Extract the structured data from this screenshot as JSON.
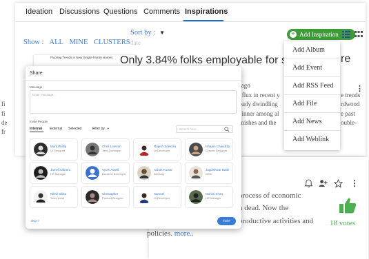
{
  "tabs": [
    "Ideation",
    "Discussions",
    "Questions",
    "Comments",
    "Inspirations"
  ],
  "active_tab": "Inspirations",
  "filters": {
    "show_label": "Show :",
    "options": [
      "ALL",
      "MINE",
      "CLUSTERS"
    ]
  },
  "sort": {
    "label": "Sort by :",
    "value": "date"
  },
  "add_button": {
    "label": "Add Inspiration",
    "color": "#3f9b3a"
  },
  "dropdown": [
    "Add Album",
    "Add Event",
    "Add RSS Feed",
    "Add File",
    "Add News",
    "Add Weblink"
  ],
  "story": {
    "headline": "Only 3.84% folks employable for sta",
    "headline_tail": "re",
    "time": "s ago",
    "lines": [
      "n flux in recent y",
      "ready dwindling",
      "winner among al",
      " finishes and the"
    ],
    "right_lines": [
      "e trends",
      "rdwood",
      "e past",
      "ouble-"
    ],
    "left_frags": [
      "fi",
      "fi",
      "de",
      "fr"
    ],
    "cover_caption": "Flooring Trends in New Single-Family Homes"
  },
  "card2": {
    "lines": [
      "process of economic",
      "n dead. Now the",
      "productive activities and",
      "policies."
    ],
    "more": "more..",
    "votes": "18 votes"
  },
  "share": {
    "title": "Share",
    "message_label": "Message :",
    "message_placeholder": "Enter message...",
    "invite_label": "Invite People",
    "tabs": [
      "Internal",
      "External",
      "Selected"
    ],
    "filter_label": "Filter by",
    "search_placeholder": "Search here...",
    "people": [
      {
        "name": "Mark Phillip",
        "role": "UI Designer"
      },
      {
        "name": "Chris Larsson",
        "role": "Java Developer"
      },
      {
        "name": "Rajesh Seekran",
        "role": "UI Developer"
      },
      {
        "name": "Ishaani Chaudray",
        "role": "Graphic Designer"
      },
      {
        "name": "Jamel Sabrero",
        "role": "HR Manager"
      },
      {
        "name": "Vyom Awelli",
        "role": "Backend Developer"
      },
      {
        "name": "Ashok Kumar",
        "role": "Advisory"
      },
      {
        "name": "Jagdishwar Bathi",
        "role": "CEO"
      },
      {
        "name": "Nikhil Sikka",
        "role": "Team Lead"
      },
      {
        "name": "Christopher",
        "role": "Product Designer"
      },
      {
        "name": "Samuel",
        "role": "UI Developer"
      },
      {
        "name": "Mohini Khan",
        "role": "HR Manager"
      }
    ],
    "skip": "skip ?",
    "invite_button": "Invite"
  },
  "colors": {
    "accent": "#3a7bd5",
    "green": "#3f9b3a",
    "vote_green": "#4caf50"
  }
}
